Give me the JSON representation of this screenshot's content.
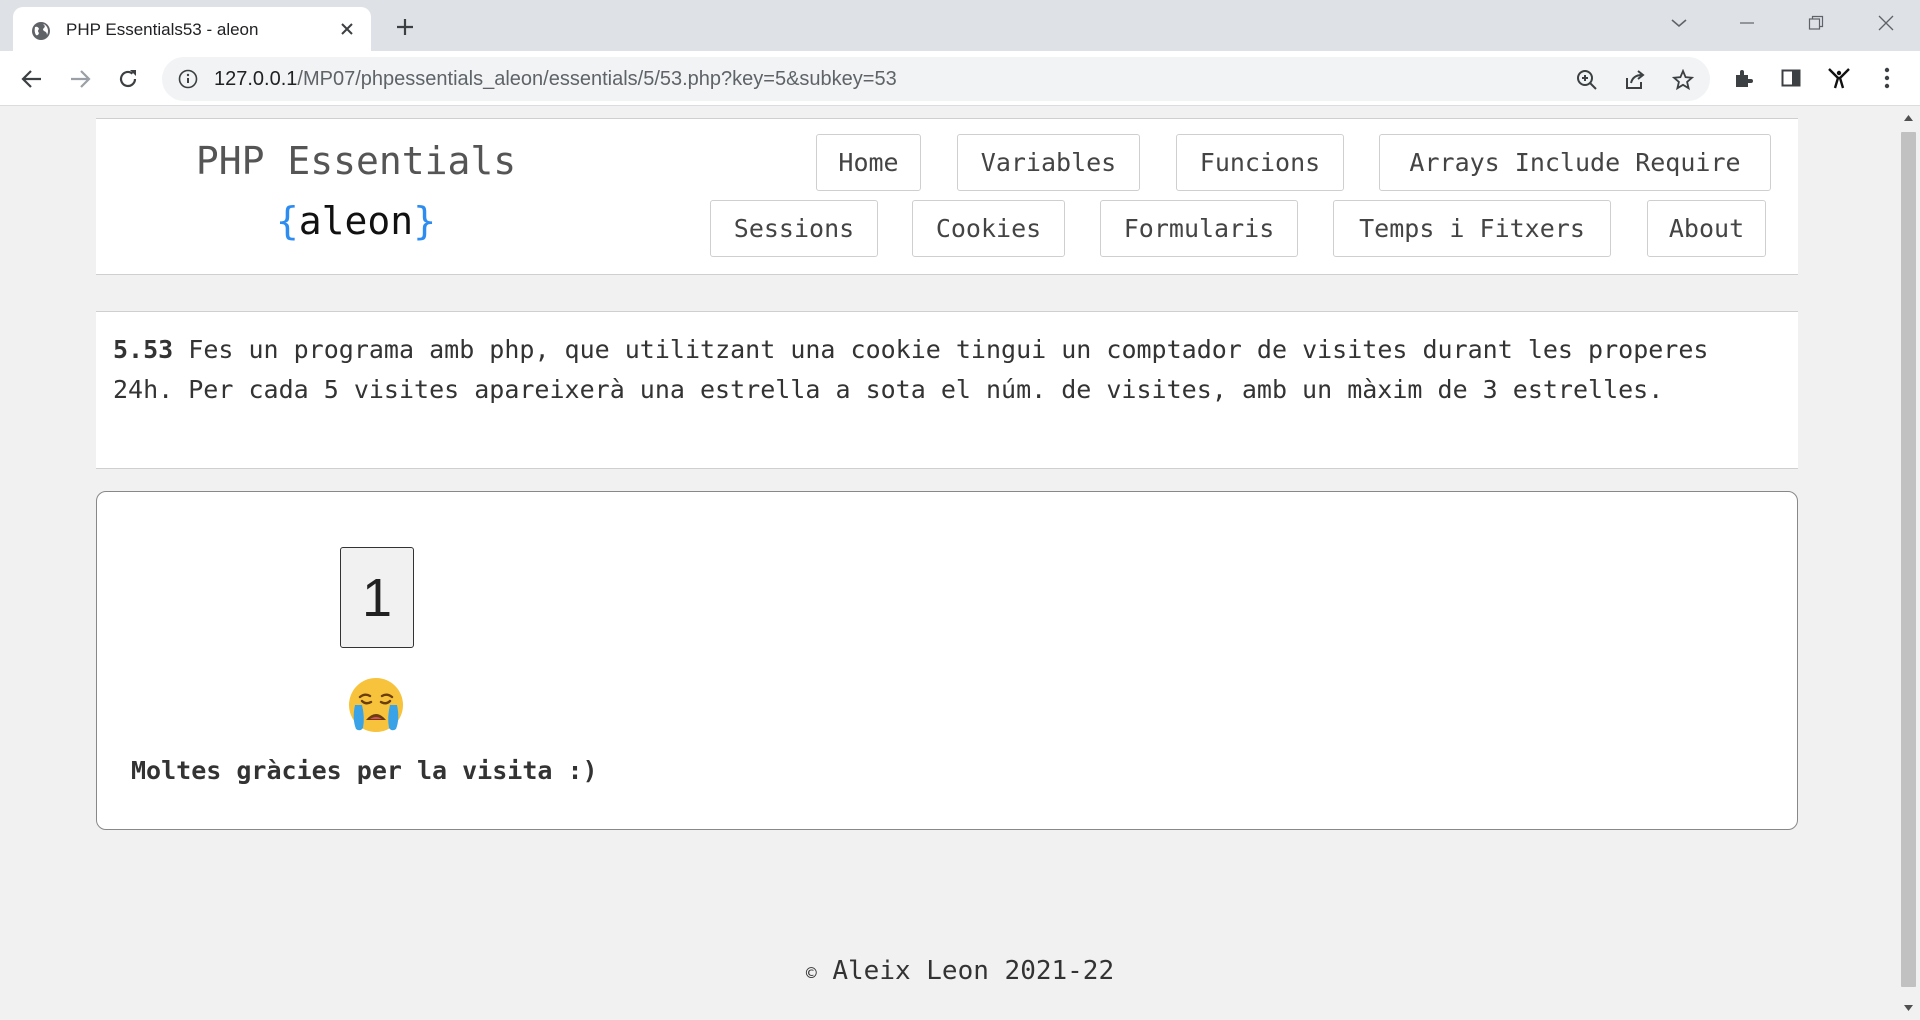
{
  "browser": {
    "tab_title": "PHP Essentials53 - aleon",
    "url_host": "127.0.0.1",
    "url_path": "/MP07/phpessentials_aleon/essentials/5/53.php?key=5&subkey=53"
  },
  "header": {
    "title": "PHP Essentials",
    "brace_open": "{",
    "author": "aleon",
    "brace_close": "}"
  },
  "nav": {
    "row1": [
      "Home",
      "Variables",
      "Funcions",
      "Arrays Include Require"
    ],
    "row2": [
      "Sessions",
      "Cookies",
      "Formularis",
      "Temps i Fitxers",
      "About"
    ]
  },
  "task": {
    "number": "5.53",
    "text": " Fes un programa amb php, que utilitzant una cookie tingui un comptador de visites durant les properes 24h. Per cada 5 visites apareixerà una estrella a sota el núm. de visites, amb un màxim de 3 estrelles."
  },
  "result": {
    "visits": "1",
    "emoji": "crying-face",
    "thanks": "Moltes gràcies per la visita :)"
  },
  "footer": {
    "copy_symbol": "©",
    "text": " Aleix Leon 2021-22"
  }
}
